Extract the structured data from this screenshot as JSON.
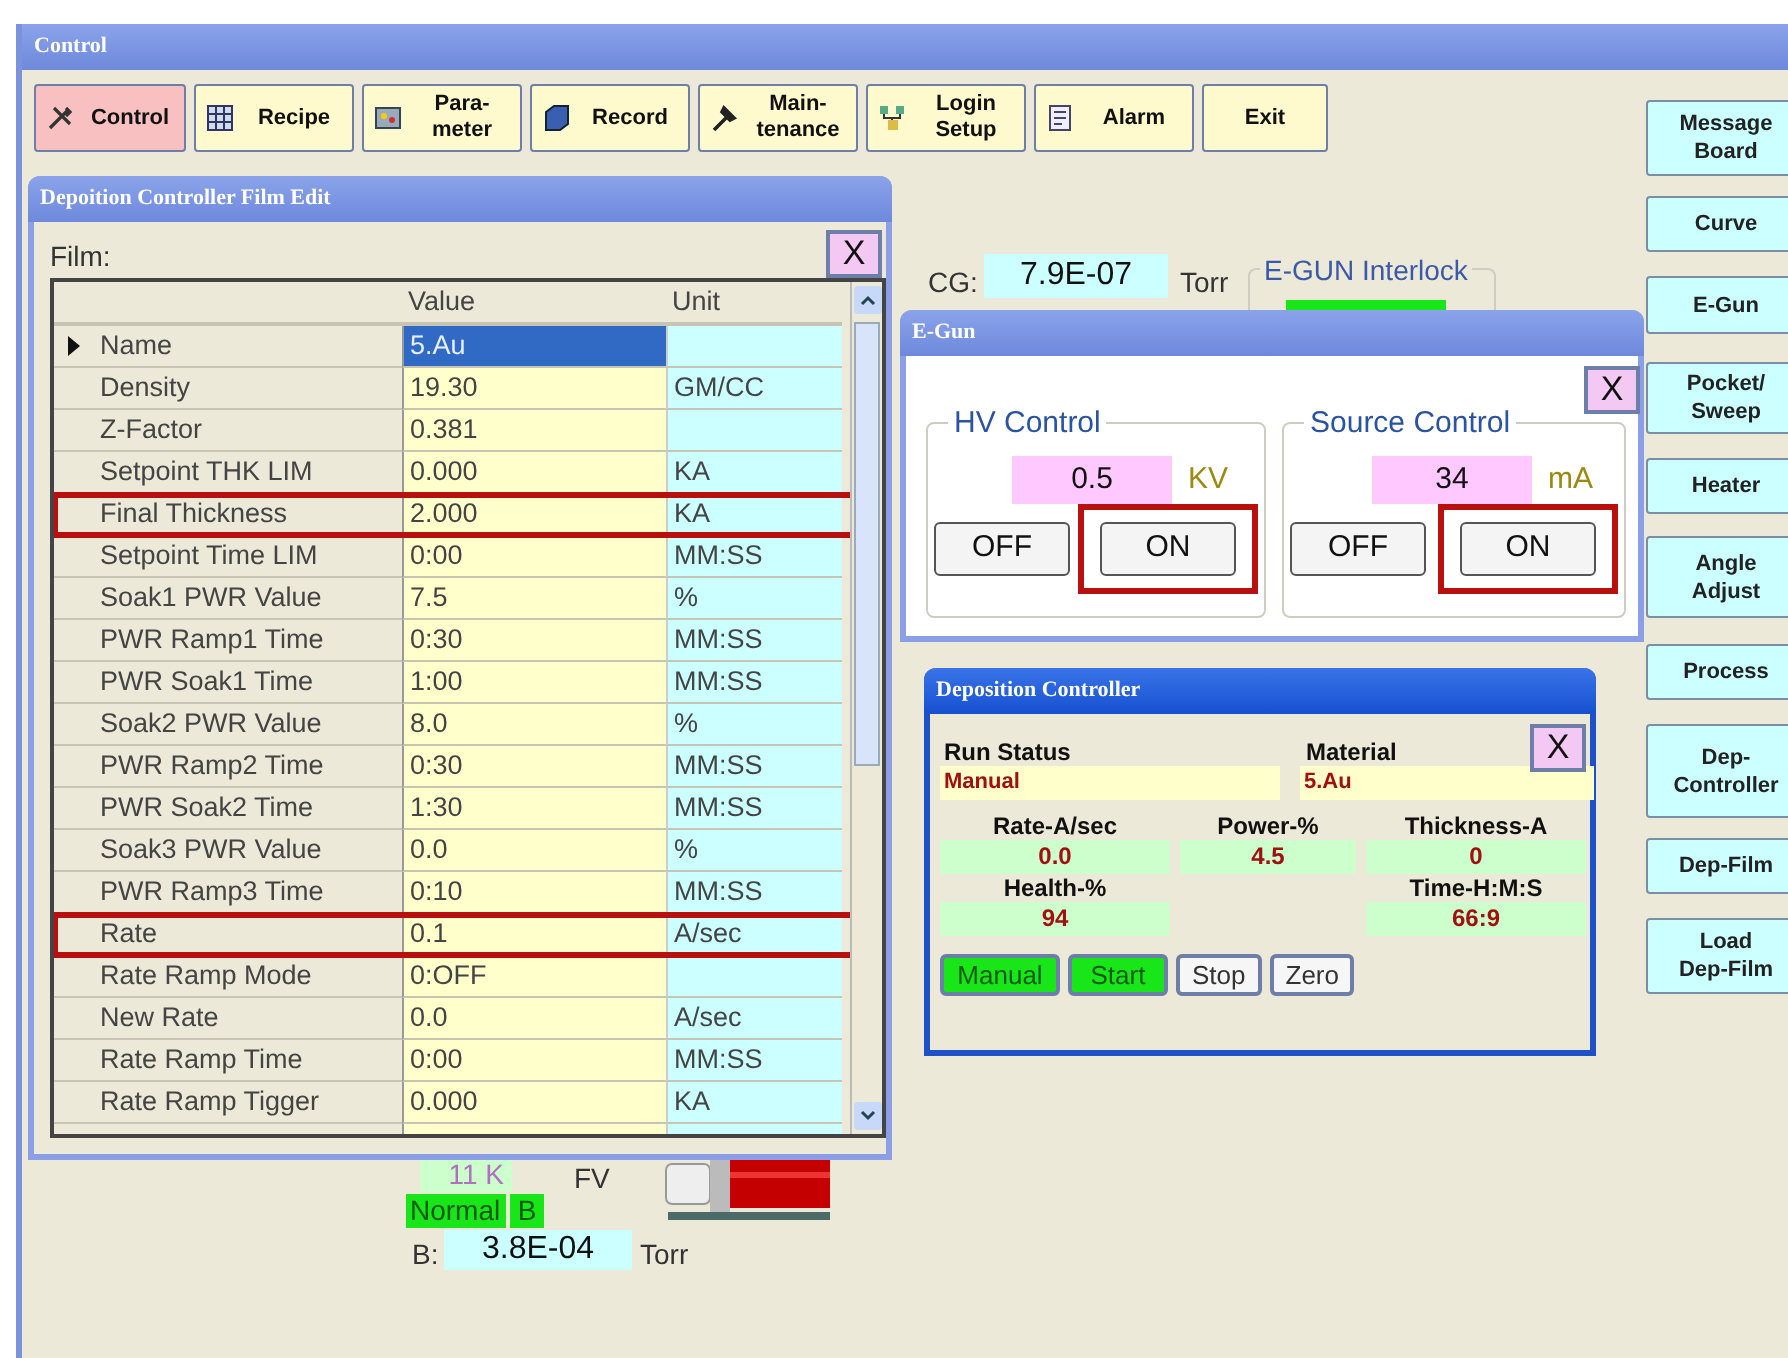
{
  "window": {
    "title": "Control"
  },
  "toolbar": [
    {
      "label": "Control",
      "selected": true
    },
    {
      "label": "Recipe",
      "selected": false
    },
    {
      "label": "Para-\nmeter",
      "selected": false
    },
    {
      "label": "Record",
      "selected": false
    },
    {
      "label": "Main-\ntenance",
      "selected": false
    },
    {
      "label": "Login\nSetup",
      "selected": false
    },
    {
      "label": "Alarm",
      "selected": false
    },
    {
      "label": "Exit",
      "selected": false
    }
  ],
  "side_buttons": [
    "Message\nBoard",
    "Curve",
    "E-Gun",
    "Pocket/\nSweep",
    "Heater",
    "Angle\nAdjust",
    "Process",
    "Dep-\nController",
    "Dep-Film",
    "Load\nDep-Film"
  ],
  "background": {
    "cg": {
      "label": "CG:",
      "value": "7.9E-07",
      "unit": "Torr"
    },
    "interlock": {
      "title": "E-GUN Interlock"
    },
    "gauge": {
      "reading": "11 K",
      "label": "FV"
    },
    "status": {
      "text": "Normal",
      "tag": "B"
    },
    "b_pressure": {
      "label": "B:",
      "value": "3.8E-04",
      "unit": "Torr"
    }
  },
  "film_edit": {
    "title": "Depoition Controller Film Edit",
    "film_label": "Film:",
    "close": "X",
    "columns": [
      "Value",
      "Unit"
    ],
    "rows": [
      {
        "name": "Name",
        "value": "5.Au",
        "unit": "",
        "selected": true,
        "highlighted": false
      },
      {
        "name": "Density",
        "value": "19.30",
        "unit": "GM/CC",
        "selected": false,
        "highlighted": false
      },
      {
        "name": "Z-Factor",
        "value": "0.381",
        "unit": "",
        "selected": false,
        "highlighted": false
      },
      {
        "name": "Setpoint THK LIM",
        "value": "0.000",
        "unit": "KA",
        "selected": false,
        "highlighted": false
      },
      {
        "name": "Final Thickness",
        "value": "2.000",
        "unit": "KA",
        "selected": false,
        "highlighted": true
      },
      {
        "name": "Setpoint Time LIM",
        "value": "0:00",
        "unit": "MM:SS",
        "selected": false,
        "highlighted": false
      },
      {
        "name": "Soak1 PWR Value",
        "value": "7.5",
        "unit": "%",
        "selected": false,
        "highlighted": false
      },
      {
        "name": "PWR Ramp1 Time",
        "value": "0:30",
        "unit": "MM:SS",
        "selected": false,
        "highlighted": false
      },
      {
        "name": "PWR Soak1 Time",
        "value": "1:00",
        "unit": "MM:SS",
        "selected": false,
        "highlighted": false
      },
      {
        "name": "Soak2 PWR Value",
        "value": "8.0",
        "unit": "%",
        "selected": false,
        "highlighted": false
      },
      {
        "name": "PWR Ramp2 Time",
        "value": "0:30",
        "unit": "MM:SS",
        "selected": false,
        "highlighted": false
      },
      {
        "name": "PWR Soak2 Time",
        "value": "1:30",
        "unit": "MM:SS",
        "selected": false,
        "highlighted": false
      },
      {
        "name": "Soak3 PWR Value",
        "value": "0.0",
        "unit": "%",
        "selected": false,
        "highlighted": false
      },
      {
        "name": "PWR Ramp3 Time",
        "value": "0:10",
        "unit": "MM:SS",
        "selected": false,
        "highlighted": false
      },
      {
        "name": "Rate",
        "value": "0.1",
        "unit": "A/sec",
        "selected": false,
        "highlighted": true
      },
      {
        "name": "Rate Ramp Mode",
        "value": "0:OFF",
        "unit": "",
        "selected": false,
        "highlighted": false
      },
      {
        "name": "New Rate",
        "value": "0.0",
        "unit": "A/sec",
        "selected": false,
        "highlighted": false
      },
      {
        "name": "Rate Ramp Time",
        "value": "0:00",
        "unit": "MM:SS",
        "selected": false,
        "highlighted": false
      },
      {
        "name": "Rate Ramp Tigger",
        "value": "0.000",
        "unit": "KA",
        "selected": false,
        "highlighted": false
      }
    ]
  },
  "egun": {
    "title": "E-Gun",
    "close": "X",
    "groups": [
      {
        "title": "HV Control",
        "value": "0.5",
        "unit": "KV",
        "buttons": [
          {
            "label": "OFF",
            "highlighted": false
          },
          {
            "label": "ON",
            "highlighted": true
          }
        ]
      },
      {
        "title": "Source Control",
        "value": "34",
        "unit": "mA",
        "buttons": [
          {
            "label": "OFF",
            "highlighted": false
          },
          {
            "label": "ON",
            "highlighted": true
          }
        ]
      }
    ]
  },
  "dep_controller": {
    "title": "Deposition Controller",
    "close": "X",
    "status_fields": [
      {
        "label": "Run Status",
        "value": "Manual"
      },
      {
        "label": "Material",
        "value": "5.Au"
      }
    ],
    "readings": [
      {
        "label": "Rate-A/sec",
        "value": "0.0"
      },
      {
        "label": "Power-%",
        "value": "4.5"
      },
      {
        "label": "Thickness-A",
        "value": "0"
      },
      {
        "label": "Health-%",
        "value": "94"
      },
      {
        "label": "Time-H:M:S",
        "value": "66:9"
      }
    ],
    "buttons": [
      {
        "label": "Manual",
        "on": true
      },
      {
        "label": "Start",
        "on": true
      },
      {
        "label": "Stop",
        "on": false
      },
      {
        "label": "Zero",
        "on": false
      }
    ]
  }
}
